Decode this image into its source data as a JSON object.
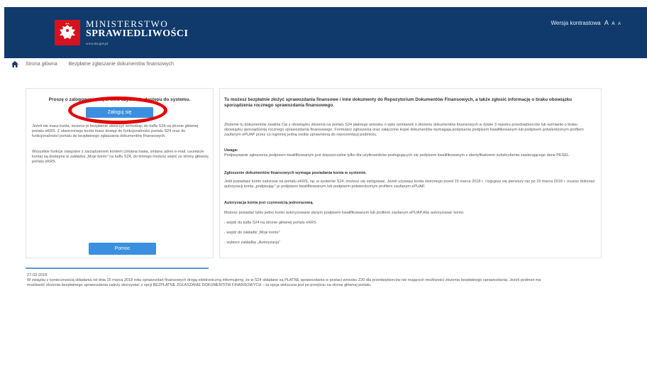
{
  "header": {
    "brand_line1": "MINISTERSTWO",
    "brand_line2": "SPRAWIEDLIWOŚCI",
    "brand_url": "www.ms.gov.pl",
    "contrast_label": "Wersja kontrastowa",
    "font_a1": "A",
    "font_a2": "A",
    "font_a3": "A",
    "colors": {
      "header_bg": "#0f3a6b",
      "logo_red": "#d5121f"
    }
  },
  "breadcrumb": {
    "home_icon": "home-icon",
    "item1": "Strona główna",
    "item2": "Bezpłatne zgłaszanie dokumentów finansowych"
  },
  "left_panel": {
    "title": "Proszę o zalogowanie się w celu uzyskania dostępu do systemu.",
    "login_button": "Zaloguj się",
    "para1": "Jeżeli nie masz konta, możesz je bezpłatnie utworzyć wchodząc do kafla S24 na stronie głównej portalu eKRS. Z utworzonego konta masz dostęp do funkcjonalności portalu S24 oraz do funkcjonalności portalu do bezpłatnego zgłaszania dokumentów finansowych.",
    "para2": "Wszystkie funkcje związane z zarządzaniem kontem (zmiana hasła, zmiana adres e-mail, usunięcie konta) są dostępne w zakładce „Moje konto” na kaflu S24, do którego możesz wejść ze strony głównej portalu eKRS.",
    "help_button": "Pomoc",
    "accent_color": "#3a8fe0",
    "highlight_color": "#e40000"
  },
  "right_panel": {
    "title": "Tu możesz bezpłatnie złożyć sprawozdania finansowe i inne dokumenty do Repozytorium Dokumentów Finansowych, a także zgłosić informację o braku obowiązku sporządzenia rocznego sprawozdania finansowego.",
    "para1": "Złożenie tu dokumentów zwalnia Cię z obowiązku złożenia na portalu S24 płatnego wniosku o wpis wzmianek o złożeniu dokumentów finansowych w dziale 3 rejestru przedsiębiorców lub wzmianki o braku obowiązku sporządzenia rocznego sprawozdania finansowego. Formularz zgłoszenia oraz załączone kopie dokumentów wymagają podpisania podpisem kwalifikowanym lub podpisem potwierdzonym profilem zaufanym ePUAP przez co najmniej jedną osobę uprawnioną do reprezentacji podmiotu.",
    "note_label": "Uwaga:",
    "note_text": "Podpisywanie zgłoszenia podpisem kwalifikowanym jest dopuszczalne tylko dla użytkowników posługujących się podpisem kwalifikowanym z identyfikatorem subskrybenta zawierającego dane PESEL.",
    "h2": "Zgłoszenie dokumentów finansowych wymaga posiadania konta w systemie.",
    "para2": "Jeśli posiadasz konto założone na portalu eKRS, np. w systemie S24, możesz się zalogować. Jeżeli używasz konta złożonego przed 15 marca 2018 r. i logujesz się pierwszy raz po 15 marca 2018 r. musisz dokonać autoryzacji konta „podpisując” je podpisem kwalifikowanym lub podpisem potwierdzonym profilem zaufanym ePUAP.",
    "h3": "Autoryzacja konta jest czynnością jednorazową.",
    "para3": "Możesz posiadać tylko jedno konto autoryzowane danym podpisem kwalifikowanym lub profilem zaufanym ePUAP.Aby autoryzować konto:",
    "step1": "- wejdź do kafla S24 na stronie głównej portalu eKRS",
    "step2": "- wejdź do zakładki „Moje konto”",
    "step3": "- wybierz zakładkę „Autoryzacja”"
  },
  "news": {
    "date": "27-03-2018",
    "text": "W związku z koniecznością składania od dnia 15 marca 2018 roku sprawozdań finansowych drogą elektroniczną informujemy, że w S24 składane są PŁATNE sprawozdania w postaci wniosku Z30 dla przedsiębiorców nie mających możliwości złożenia bezpłatnego sprawozdania. Jeżeli podmiot ma możliwość złożenia bezpłatnego sprawozdania należy skorzystać z opcji BEZPŁATNE ZGŁASZANIE DOKUMENTÓW FINANSOWYCH – ta opcja widoczna jest po przejściu na stronę głównej portalu."
  }
}
